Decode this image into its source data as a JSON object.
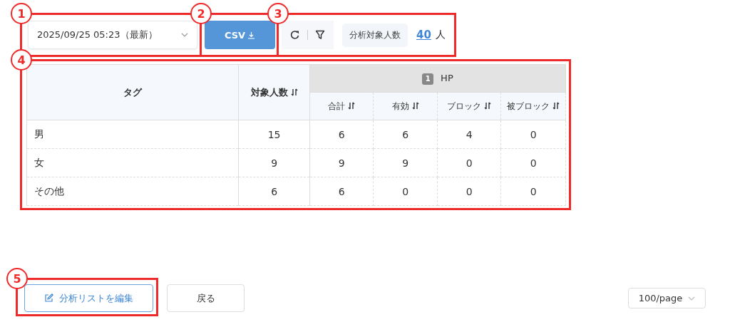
{
  "callouts": [
    "1",
    "2",
    "3",
    "4",
    "5"
  ],
  "toolbar": {
    "snapshot_select": {
      "value": "2025/09/25 05:23（最新）"
    },
    "csv_button": {
      "label": "CSV"
    },
    "target_label": "分析対象人数",
    "target_count": "40",
    "target_unit": "人"
  },
  "table": {
    "columns": [
      {
        "label": "タグ",
        "sortable": false
      },
      {
        "label": "対象人数",
        "sortable": true
      }
    ],
    "group": {
      "badge": "1",
      "label": "HP"
    },
    "sub_columns": [
      {
        "label": "合計",
        "sortable": true
      },
      {
        "label": "有効",
        "sortable": true
      },
      {
        "label": "ブロック",
        "sortable": true
      },
      {
        "label": "被ブロック",
        "sortable": true
      }
    ],
    "rows": [
      {
        "tag": "男",
        "count": "15",
        "values": [
          "6",
          "6",
          "4",
          "0"
        ]
      },
      {
        "tag": "女",
        "count": "9",
        "values": [
          "9",
          "9",
          "0",
          "0"
        ]
      },
      {
        "tag": "その他",
        "count": "6",
        "values": [
          "6",
          "0",
          "0",
          "0"
        ]
      }
    ]
  },
  "footer": {
    "edit_button": "分析リストを編集",
    "back_button": "戻る",
    "page_size": "100/page"
  }
}
